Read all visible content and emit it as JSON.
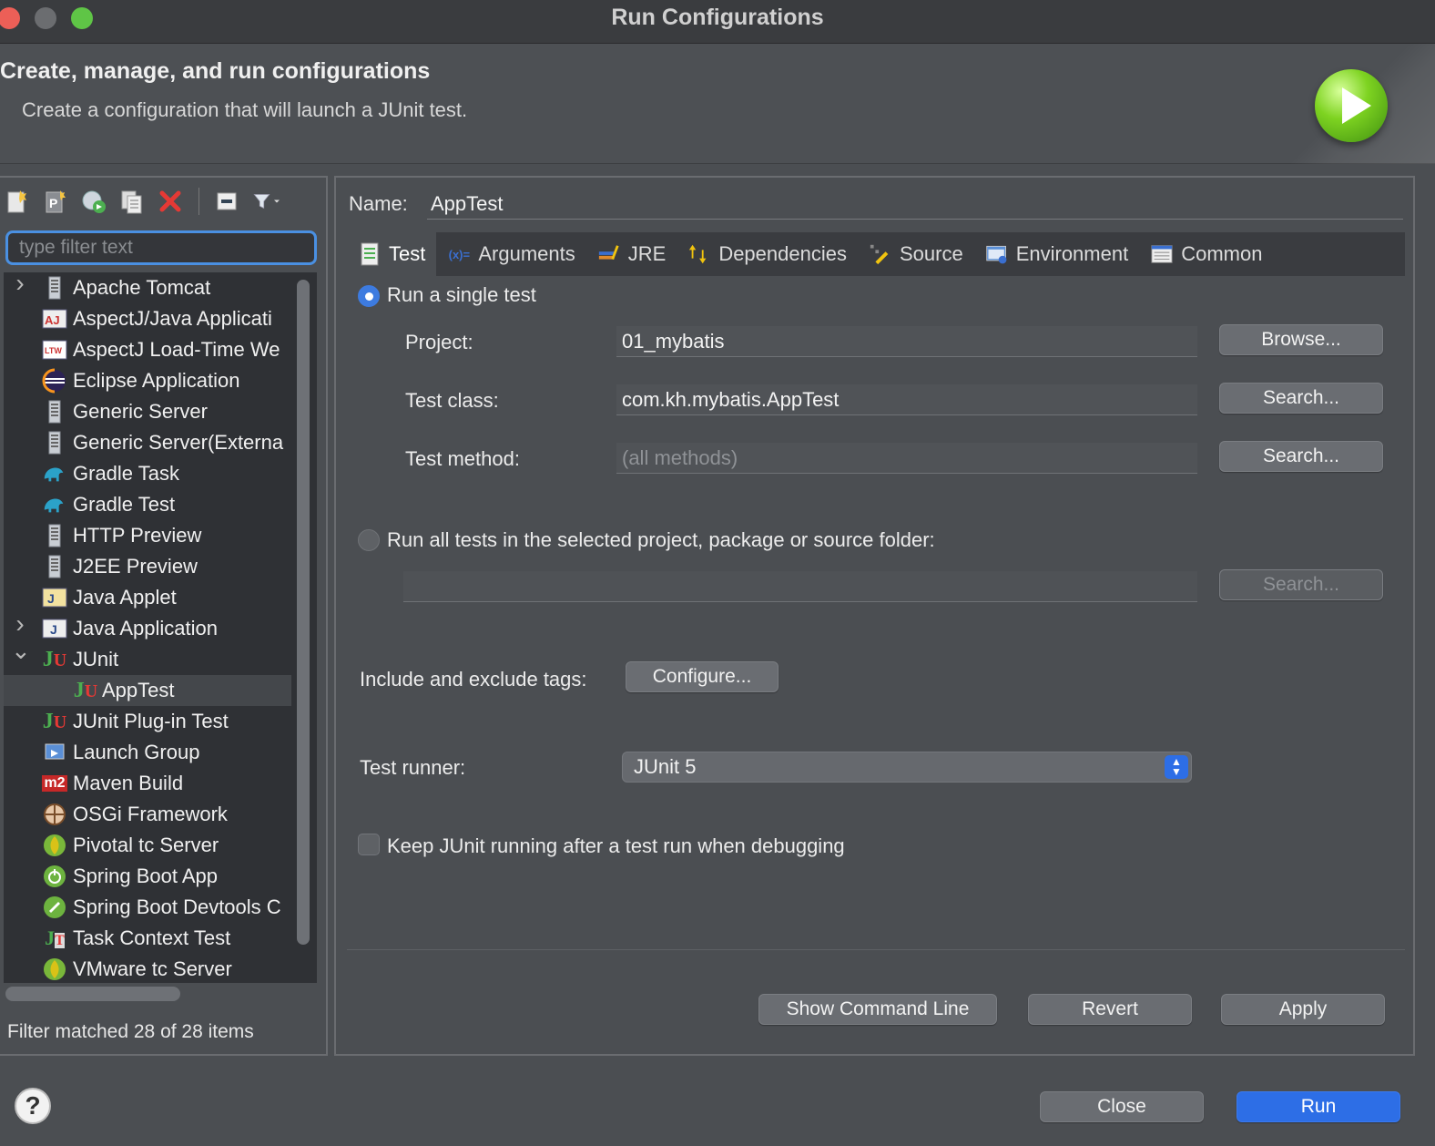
{
  "window": {
    "title": "Run Configurations"
  },
  "header": {
    "title": "Create, manage, and run configurations",
    "subtitle": "Create a configuration that will launch a JUnit test."
  },
  "left": {
    "filter_placeholder": "type filter text",
    "filter_status": "Filter matched 28 of 28 items",
    "toolbar": [
      "new-config-icon",
      "new-prototype-icon",
      "export-icon",
      "duplicate-icon",
      "delete-icon",
      "collapse-all-icon",
      "filter-icon"
    ],
    "tree": [
      {
        "label": "Apache Tomcat",
        "icon": "server-icon",
        "expandable": "collapsed"
      },
      {
        "label": "AspectJ/Java Applicati",
        "icon": "aj-icon",
        "expandable": ""
      },
      {
        "label": "AspectJ Load-Time We",
        "icon": "ltw-icon",
        "expandable": ""
      },
      {
        "label": "Eclipse Application",
        "icon": "eclipse-icon",
        "expandable": ""
      },
      {
        "label": "Generic Server",
        "icon": "server-icon",
        "expandable": ""
      },
      {
        "label": "Generic Server(Externa",
        "icon": "server-icon",
        "expandable": ""
      },
      {
        "label": "Gradle Task",
        "icon": "gradle-icon",
        "expandable": ""
      },
      {
        "label": "Gradle Test",
        "icon": "gradle-icon",
        "expandable": ""
      },
      {
        "label": "HTTP Preview",
        "icon": "server-icon",
        "expandable": ""
      },
      {
        "label": "J2EE Preview",
        "icon": "server-icon",
        "expandable": ""
      },
      {
        "label": "Java Applet",
        "icon": "applet-icon",
        "expandable": ""
      },
      {
        "label": "Java Application",
        "icon": "java-app-icon",
        "expandable": "collapsed"
      },
      {
        "label": "JUnit",
        "icon": "junit-icon",
        "expandable": "expanded"
      },
      {
        "label": "AppTest",
        "icon": "junit-icon",
        "expandable": "",
        "child": true,
        "selected": true
      },
      {
        "label": "JUnit Plug-in Test",
        "icon": "junit-plugin-icon",
        "expandable": ""
      },
      {
        "label": "Launch Group",
        "icon": "launch-group-icon",
        "expandable": ""
      },
      {
        "label": "Maven Build",
        "icon": "maven-icon",
        "expandable": ""
      },
      {
        "label": "OSGi Framework",
        "icon": "osgi-icon",
        "expandable": ""
      },
      {
        "label": "Pivotal tc Server",
        "icon": "leaf-icon",
        "expandable": ""
      },
      {
        "label": "Spring Boot App",
        "icon": "spring-boot-icon",
        "expandable": ""
      },
      {
        "label": "Spring Boot Devtools C",
        "icon": "spring-devtools-icon",
        "expandable": ""
      },
      {
        "label": "Task Context Test",
        "icon": "task-context-icon",
        "expandable": ""
      },
      {
        "label": "VMware tc Server",
        "icon": "leaf-icon",
        "expandable": ""
      }
    ]
  },
  "right": {
    "name_label": "Name:",
    "name_value": "AppTest",
    "tabs": [
      {
        "label": "Test",
        "icon": "test-tab-icon"
      },
      {
        "label": "Arguments",
        "icon": "arguments-tab-icon"
      },
      {
        "label": "JRE",
        "icon": "jre-tab-icon"
      },
      {
        "label": "Dependencies",
        "icon": "dependencies-tab-icon"
      },
      {
        "label": "Source",
        "icon": "source-tab-icon"
      },
      {
        "label": "Environment",
        "icon": "environment-tab-icon"
      },
      {
        "label": "Common",
        "icon": "common-tab-icon"
      }
    ],
    "single_test_label": "Run a single test",
    "project_label": "Project:",
    "project_value": "01_mybatis",
    "browse_label": "Browse...",
    "test_class_label": "Test class:",
    "test_class_value": "com.kh.mybatis.AppTest",
    "search_label": "Search...",
    "test_method_label": "Test method:",
    "test_method_placeholder": "(all methods)",
    "run_all_label": "Run all tests in the selected project, package or source folder:",
    "run_all_value": "",
    "tags_label": "Include and exclude tags:",
    "configure_label": "Configure...",
    "runner_label": "Test runner:",
    "runner_value": "JUnit 5",
    "keep_running_label": "Keep JUnit running after a test run when debugging",
    "show_command_line_label": "Show Command Line",
    "revert_label": "Revert",
    "apply_label": "Apply"
  },
  "footer": {
    "close_label": "Close",
    "run_label": "Run"
  },
  "colors": {
    "accent": "#2d6ee6",
    "focus": "#4a90e2",
    "background": "#4b4e52"
  }
}
